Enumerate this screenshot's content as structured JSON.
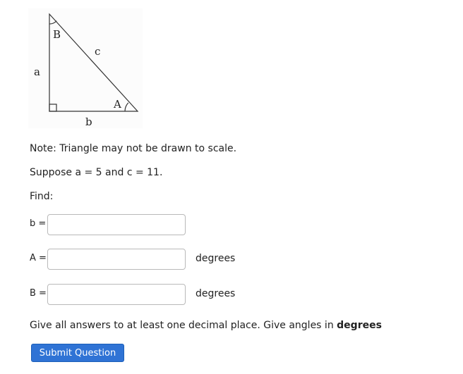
{
  "figure": {
    "vertex_B": "B",
    "vertex_A": "A",
    "side_a": "a",
    "side_b": "b",
    "side_c": "c"
  },
  "note": "Note: Triangle may not be drawn to scale.",
  "suppose": "Suppose a = 5 and c = 11.",
  "find": "Find:",
  "answers": [
    {
      "label": "b =",
      "value": "",
      "unit": ""
    },
    {
      "label": "A =",
      "value": "",
      "unit": "degrees"
    },
    {
      "label": "B =",
      "value": "",
      "unit": "degrees"
    }
  ],
  "instructions": {
    "text": "Give all answers to at least one decimal place. Give angles in ",
    "emphasis": "degrees"
  },
  "submit_label": "Submit Question",
  "colors": {
    "button_bg": "#2f73d5",
    "text": "#222222",
    "input_border": "#b9b9b9"
  }
}
